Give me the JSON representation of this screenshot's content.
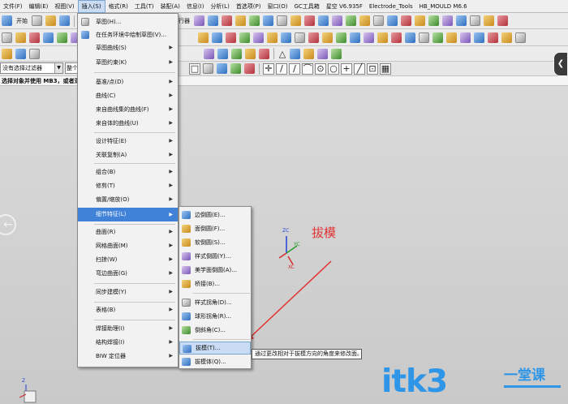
{
  "menubar": {
    "items": [
      {
        "label": "文件(F)"
      },
      {
        "label": "编辑(E)"
      },
      {
        "label": "视图(V)"
      },
      {
        "label": "插入(S)"
      },
      {
        "label": "格式(R)"
      },
      {
        "label": "工具(T)"
      },
      {
        "label": "装配(A)"
      },
      {
        "label": "信息(I)"
      },
      {
        "label": "分析(L)"
      },
      {
        "label": "首选项(P)"
      },
      {
        "label": "窗口(O)"
      },
      {
        "label": "GC工具箱"
      },
      {
        "label": "星空 V6.935F"
      },
      {
        "label": "Electrode_Tools"
      },
      {
        "label": "HB_MOULD M6.6"
      }
    ]
  },
  "toolbar": {
    "start_label": "开始",
    "partial_label": "集执行器"
  },
  "selection_bar": {
    "filter_value": "没有选择过滤器",
    "scope_value": "整个"
  },
  "status_bar": {
    "text": "选择对象并使用 MB3，或者双"
  },
  "insert_menu": {
    "items": [
      {
        "label": "草图(H)...",
        "has_sub": false
      },
      {
        "label": "在任务环境中绘制草图(V)...",
        "has_sub": false
      },
      {
        "label": "草图曲线(S)",
        "has_sub": true
      },
      {
        "label": "草图约束(K)",
        "has_sub": true
      },
      {
        "label": "基准/点(D)",
        "has_sub": true
      },
      {
        "label": "曲线(C)",
        "has_sub": true
      },
      {
        "label": "来自曲线集的曲线(F)",
        "has_sub": true
      },
      {
        "label": "来自体的曲线(U)",
        "has_sub": true
      },
      {
        "label": "设计特征(E)",
        "has_sub": true
      },
      {
        "label": "关联复制(A)",
        "has_sub": true
      },
      {
        "label": "组合(B)",
        "has_sub": true
      },
      {
        "label": "修剪(T)",
        "has_sub": true
      },
      {
        "label": "偏置/缩放(O)",
        "has_sub": true
      },
      {
        "label": "细节特征(L)",
        "has_sub": true,
        "selected": true
      },
      {
        "label": "曲面(R)",
        "has_sub": true
      },
      {
        "label": "网格曲面(M)",
        "has_sub": true
      },
      {
        "label": "扫掠(W)",
        "has_sub": true
      },
      {
        "label": "弯边曲面(G)",
        "has_sub": true
      },
      {
        "label": "同步建模(Y)",
        "has_sub": true
      },
      {
        "label": "表格(B)",
        "has_sub": true
      },
      {
        "label": "焊接助理(I)",
        "has_sub": true
      },
      {
        "label": "结构焊接(I)",
        "has_sub": true
      },
      {
        "label": "BIW 定位器",
        "has_sub": true
      }
    ]
  },
  "detail_submenu": {
    "items": [
      {
        "label": "边倒圆(E)..."
      },
      {
        "label": "面倒圆(F)..."
      },
      {
        "label": "软倒圆(S)..."
      },
      {
        "label": "样式倒圆(Y)..."
      },
      {
        "label": "美学面倒圆(A)..."
      },
      {
        "label": "桥接(B)..."
      },
      {
        "label": "样式拐角(D)..."
      },
      {
        "label": "球形拐角(R)..."
      },
      {
        "label": "倒斜角(C)..."
      },
      {
        "label": "拔模(T)...",
        "selected": true
      },
      {
        "label": "拔模体(Q)..."
      }
    ]
  },
  "tooltip": {
    "text": "通过更改相对于拔模方向的角度来修改面。"
  },
  "annotation": {
    "text": "拔模",
    "color": "#e23131"
  },
  "triad": {
    "zc": "ZC",
    "yc": "YC",
    "xc": "XC",
    "small_z": "Z"
  },
  "watermark": {
    "main": "itk3",
    "sub": "一堂课",
    "color": "#2f95e7"
  },
  "colors": {
    "menu_selected": "#3f82d8",
    "hover_highlight": "#c9dcf4"
  }
}
